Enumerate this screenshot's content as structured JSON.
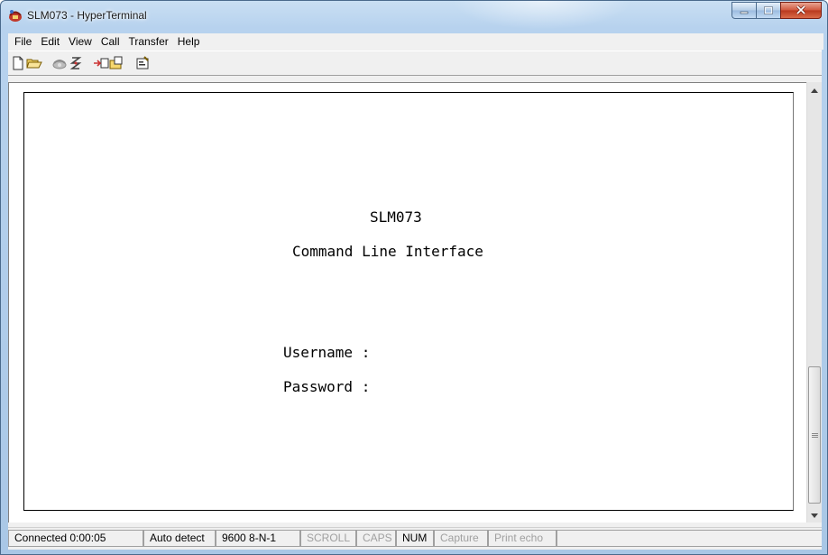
{
  "window": {
    "title": "SLM073 - HyperTerminal",
    "app_icon": "hyperterminal-phone-icon",
    "controls": [
      "minimize-icon",
      "maximize-icon",
      "close-icon"
    ]
  },
  "menu": [
    "File",
    "Edit",
    "View",
    "Call",
    "Transfer",
    "Help"
  ],
  "toolbar": [
    {
      "name": "new-icon"
    },
    {
      "name": "open-icon"
    },
    {
      "name": "call-icon"
    },
    {
      "name": "disconnect-icon"
    },
    {
      "name": "send-icon"
    },
    {
      "name": "receive-icon"
    },
    {
      "name": "properties-icon"
    }
  ],
  "terminal": {
    "device": "SLM073",
    "subtitle": "Command Line Interface",
    "username_prompt": "Username :",
    "password_prompt": "Password :"
  },
  "status": [
    {
      "text": "Connected 0:00:05",
      "active": true
    },
    {
      "text": "Auto detect",
      "active": true
    },
    {
      "text": "9600 8-N-1",
      "active": true
    },
    {
      "text": "SCROLL",
      "active": false
    },
    {
      "text": "CAPS",
      "active": false
    },
    {
      "text": "NUM",
      "active": true
    },
    {
      "text": "Capture",
      "active": false
    },
    {
      "text": "Print echo",
      "active": false
    }
  ],
  "colors": {
    "titlebar": "#b7d2ee",
    "close_button": "#c8472b",
    "terminal_bg": "#ffffff",
    "terminal_text": "#000000"
  }
}
